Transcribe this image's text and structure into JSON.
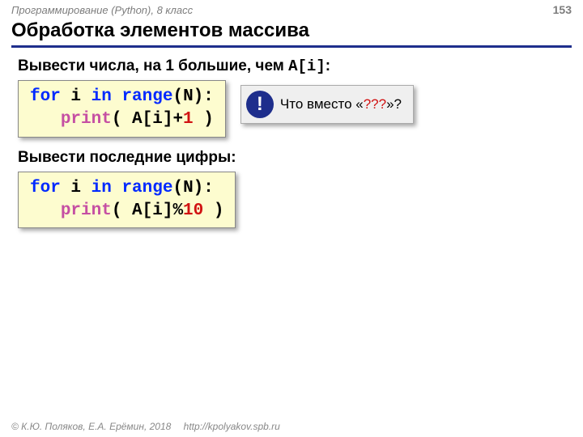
{
  "header": {
    "course": "Программирование (Python), 8 класс",
    "page": "153"
  },
  "title": "Обработка элементов массива",
  "task1": {
    "prefix": "Вывести числа, на 1 большие, чем ",
    "var": "A[i]",
    "suffix": ":"
  },
  "code1": {
    "for": "for",
    "i": " i ",
    "in": "in",
    "range": " range",
    "args1": "(N):",
    "indent": "   ",
    "print": "print",
    "lparen": "( A[i]+",
    "one": "1",
    "rparen": " )"
  },
  "callout": {
    "bang": "!",
    "before": "Что вместо «",
    "q": "???",
    "after": "»?"
  },
  "task2": "Вывести последние цифры:",
  "code2": {
    "for": "for",
    "i": " i ",
    "in": "in",
    "range": " range",
    "args1": "(N):",
    "indent": "   ",
    "print": "print",
    "lparen": "( A[i]%",
    "ten": "10",
    "rparen": " )"
  },
  "footer": {
    "copyright": "© К.Ю. Поляков, Е.А. Ерёмин, 2018",
    "link": "http://kpolyakov.spb.ru"
  }
}
